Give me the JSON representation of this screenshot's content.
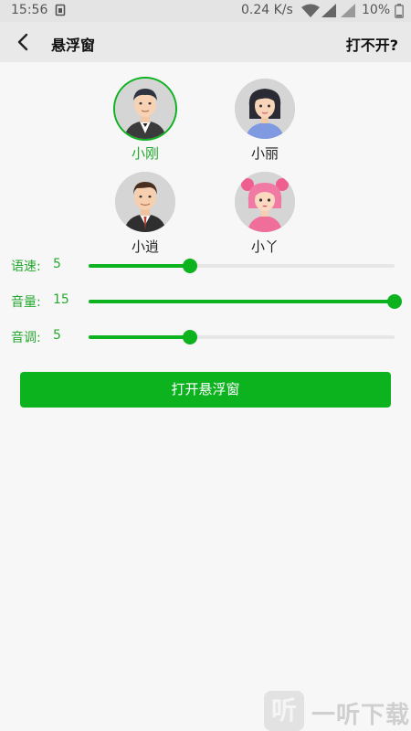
{
  "status_bar": {
    "time": "15:56",
    "speed": "0.24 K/s",
    "battery": "10%"
  },
  "header": {
    "title": "悬浮窗",
    "help": "打不开?"
  },
  "voices": [
    {
      "name": "小刚",
      "selected": true
    },
    {
      "name": "小丽",
      "selected": false
    },
    {
      "name": "小逍",
      "selected": false
    },
    {
      "name": "小丫",
      "selected": false
    }
  ],
  "sliders": {
    "speed": {
      "label": "语速:",
      "value": "5",
      "level": 0.33
    },
    "volume": {
      "label": "音量:",
      "value": "15",
      "level": 1.0
    },
    "pitch": {
      "label": "音调:",
      "value": "5",
      "level": 0.33
    }
  },
  "action": {
    "open_label": "打开悬浮窗"
  },
  "watermark": {
    "logo": "听",
    "text": "一听下载"
  },
  "colors": {
    "accent": "#0db21f",
    "selected_text": "#25a82f"
  }
}
